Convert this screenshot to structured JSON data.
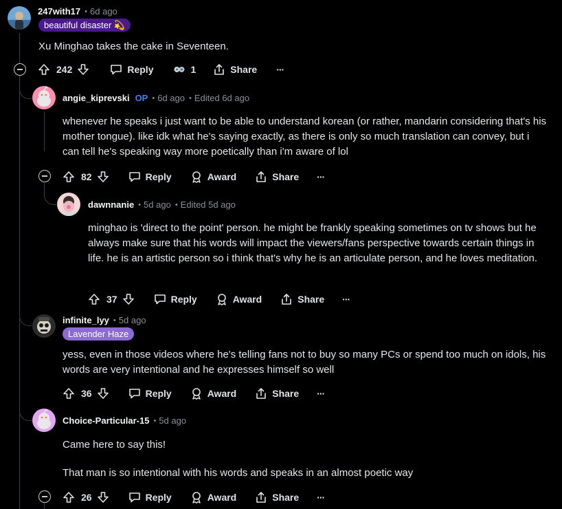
{
  "comments": [
    {
      "username": "247with17",
      "age": "6d ago",
      "flair": "beautiful disaster 💫",
      "flair_color": "#4a1a8c",
      "body": [
        "Xu Minghao takes the cake in Seventeen."
      ],
      "votes": "242",
      "reply": "Reply",
      "award_count": "1",
      "share": "Share",
      "more": "···"
    },
    {
      "username": "angie_kiprevski",
      "op_badge": "OP",
      "age": "6d ago",
      "edited": "Edited 6d ago",
      "body": [
        "whenever he speaks i just want to be able to understand korean (or rather, mandarin considering that's his mother tongue). like idk what he's saying exactly, as there is only so much translation can convey, but i can tell he's speaking way more poetically than i'm aware of lol"
      ],
      "votes": "82",
      "reply": "Reply",
      "award": "Award",
      "share": "Share",
      "more": "···"
    },
    {
      "username": "dawnnanie",
      "age": "5d ago",
      "edited": "Edited 5d ago",
      "body": [
        "minghao is 'direct to the point' person. he might be frankly speaking sometimes on tv shows but he always make sure that his words will impact the viewers/fans perspective towards certain things in life. he is an artistic person so i think that's why he is an articulate person, and he loves meditation."
      ],
      "votes": "37",
      "reply": "Reply",
      "award": "Award",
      "share": "Share",
      "more": "···"
    },
    {
      "username": "infinite_lyy",
      "age": "5d ago",
      "flair": "Lavender Haze",
      "flair_color": "#8c6bd6",
      "body": [
        "yess, even in those videos where he's telling fans not to buy so many PCs or spend too much on idols, his words are very intentional and he expresses himself so well"
      ],
      "votes": "36",
      "reply": "Reply",
      "award": "Award",
      "share": "Share",
      "more": "···"
    },
    {
      "username": "Choice-Particular-15",
      "age": "5d ago",
      "body": [
        "Came here to say this!",
        "That man is so intentional with his words and speaks in an almost poetic way"
      ],
      "votes": "26",
      "reply": "Reply",
      "award": "Award",
      "share": "Share",
      "more": "···"
    }
  ],
  "icons": {
    "upvote": "arrow-up-icon",
    "downvote": "arrow-down-icon",
    "reply": "speech-bubble-icon",
    "award": "award-ribbon-icon",
    "share": "share-icon",
    "collapse": "minus-circle-icon"
  },
  "colors": {
    "background": "#000000",
    "text": "#dfe3e6",
    "muted": "#8a9095",
    "op": "#3b82f6",
    "thread_line": "#3a3f44"
  }
}
